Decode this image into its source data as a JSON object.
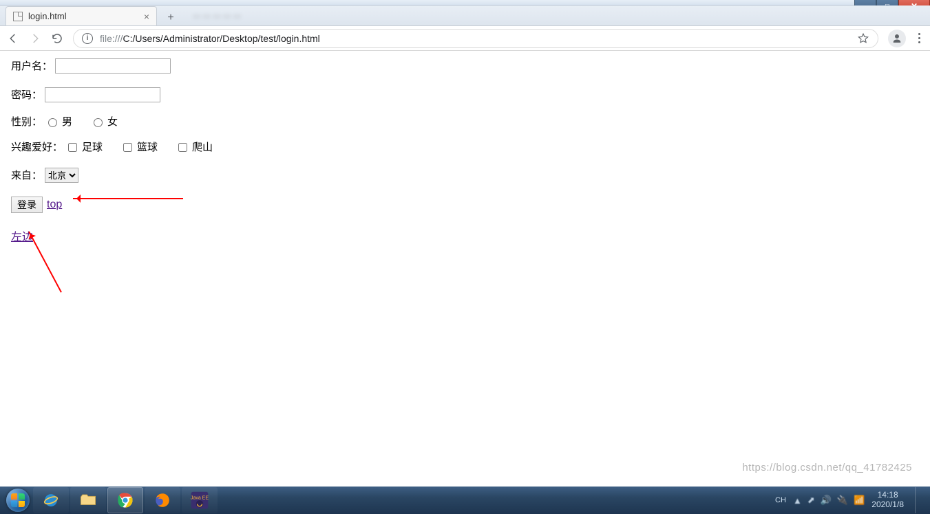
{
  "window": {
    "tab_title": "login.html",
    "win_min_glyph": "—",
    "win_max_glyph": "□",
    "win_close_glyph": "✕",
    "newtab_glyph": "+"
  },
  "addressbar": {
    "protocol_icon": "ⓘ",
    "url_scheme_host": "file:///",
    "url_path": "C:/Users/Administrator/Desktop/test/login.html"
  },
  "form": {
    "username_label": "用户名：",
    "username_value": "",
    "password_label": "密码：",
    "password_value": "",
    "gender_label": "性别：",
    "gender_options": [
      "男",
      "女"
    ],
    "hobby_label": "兴趣爱好：",
    "hobby_options": [
      "足球",
      "篮球",
      "爬山"
    ],
    "from_label": "来自：",
    "from_selected": "北京",
    "from_options": [
      "北京"
    ],
    "submit_label": "登录",
    "link_top": "top",
    "link_left": "左边"
  },
  "taskbar": {
    "ime": "CH",
    "time": "14:18",
    "date": "2020/1/8",
    "tray_glyphs": [
      "▲",
      "⬈",
      "🔊",
      "🔌",
      "📶"
    ]
  },
  "watermark": "https://blog.csdn.net/qq_41782425"
}
